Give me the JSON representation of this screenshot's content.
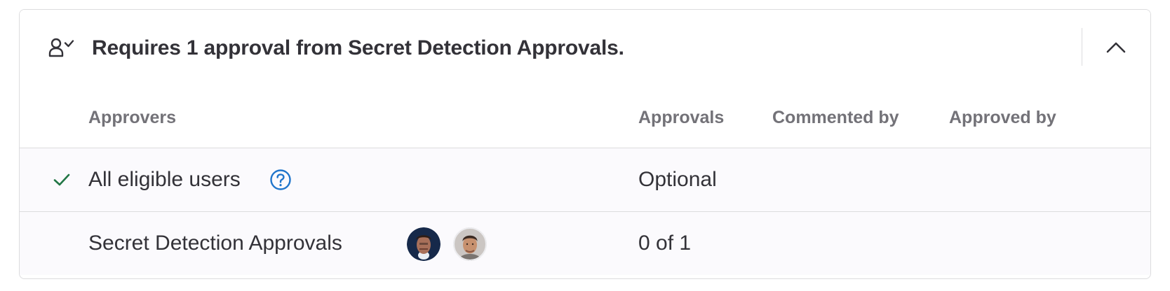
{
  "header": {
    "title": "Requires 1 approval from Secret Detection Approvals.",
    "approval_icon": "approval-user-check-icon",
    "collapse_icon": "chevron-up-icon"
  },
  "columns": {
    "approvers": "Approvers",
    "approvals": "Approvals",
    "commented_by": "Commented by",
    "approved_by": "Approved by"
  },
  "rows": [
    {
      "status_icon": "check-icon",
      "approvers": "All eligible users",
      "help_icon": "question-circle-icon",
      "approvals": "Optional"
    },
    {
      "approvers": "Secret Detection Approvals",
      "avatars": [
        "user-avatar",
        "user-avatar"
      ],
      "approvals": "0 of 1"
    }
  ],
  "colors": {
    "text": "#333238",
    "muted": "#737278",
    "success": "#217645",
    "link": "#1f75cb",
    "border": "#dcdcde",
    "row_background": "#fbfafd"
  }
}
